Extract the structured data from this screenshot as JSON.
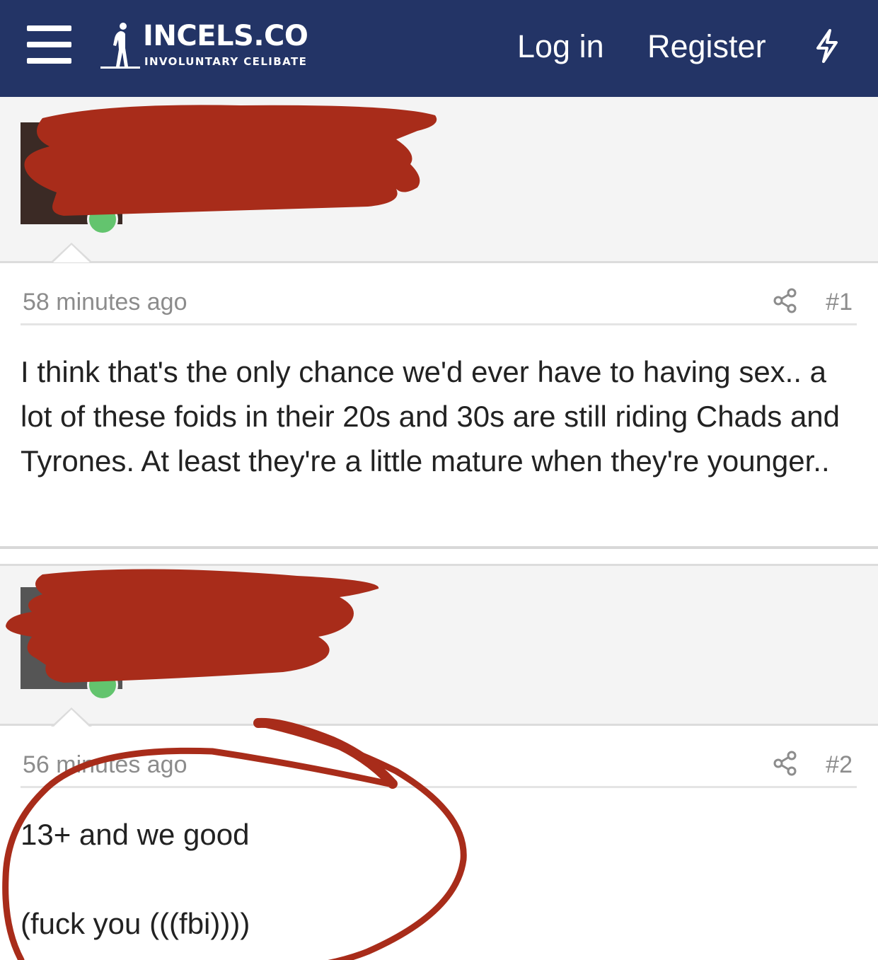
{
  "header": {
    "logo_title": "INCELS.CO",
    "logo_subtitle": "INVOLUNTARY CELIBATE",
    "login_label": "Log in",
    "register_label": "Register",
    "bolt_icon": "lightning-bolt-icon",
    "menu_icon": "hamburger-menu-icon"
  },
  "posts": [
    {
      "time": "58 minutes ago",
      "number": "#1",
      "body": [
        "I think that's the only chance we'd ever have to having sex.. a lot of these foids in their 20s and 30s are still riding Chads and Tyrones. At least they're a little mature when they're younger.."
      ]
    },
    {
      "time": "56 minutes ago",
      "number": "#2",
      "body": [
        "13+ and we good",
        "(fuck you (((fbi))))"
      ]
    }
  ],
  "colors": {
    "header_bg": "#233466",
    "redaction": "#a82c1a",
    "online": "#63c46e"
  }
}
